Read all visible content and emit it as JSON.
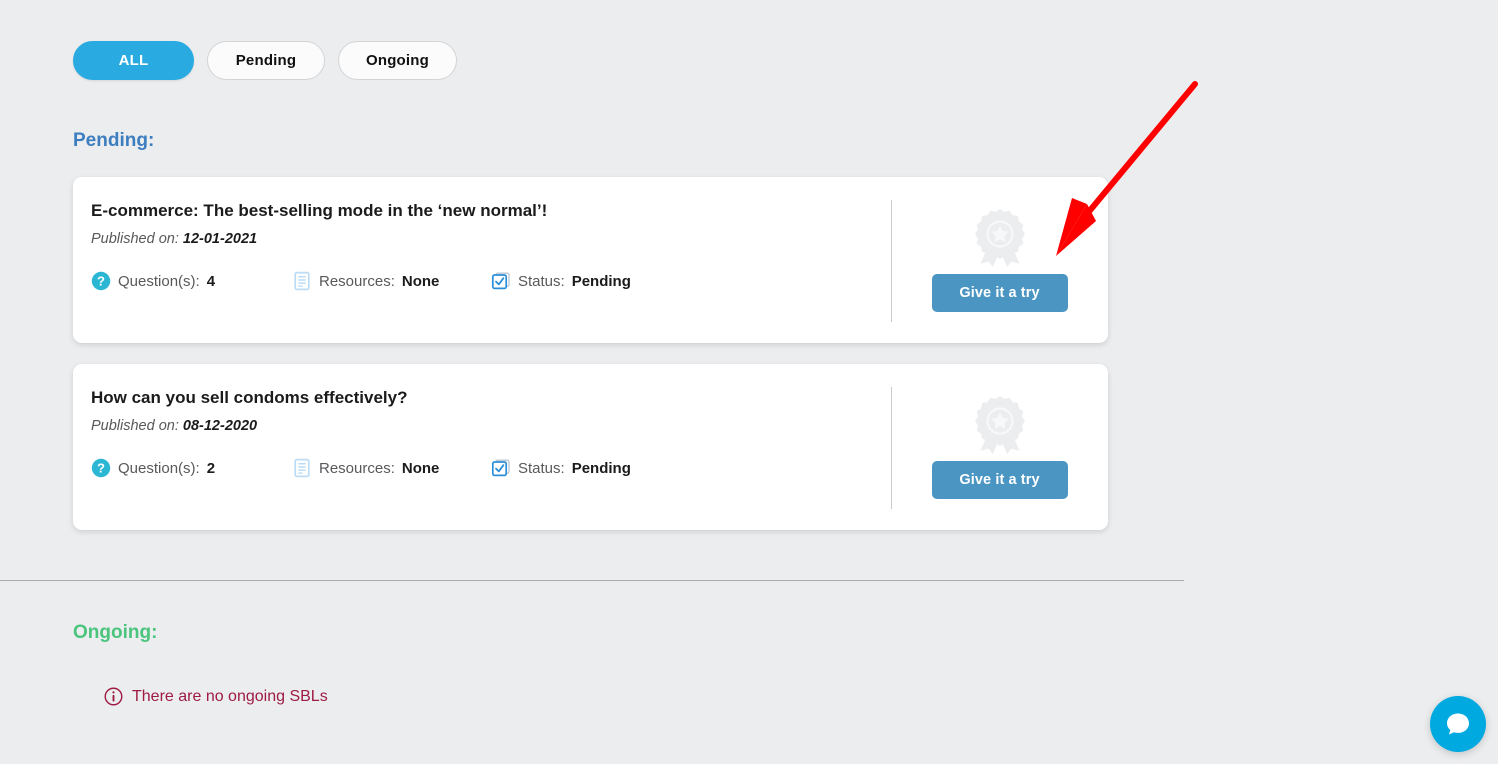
{
  "filters": {
    "tabs": [
      {
        "label": "ALL",
        "active": true,
        "name": "filter-tab-all"
      },
      {
        "label": "Pending",
        "active": false,
        "name": "filter-tab-pending"
      },
      {
        "label": "Ongoing",
        "active": false,
        "name": "filter-tab-ongoing"
      }
    ]
  },
  "sections": {
    "pending": {
      "heading": "Pending:",
      "heading_color": "#3d7ec0"
    },
    "ongoing": {
      "heading": "Ongoing:",
      "heading_color": "#4bc47d",
      "empty_message": "There are no ongoing SBLs",
      "empty_icon": "info-circle-icon",
      "empty_color": "#9e1b43"
    }
  },
  "cards": [
    {
      "title": "E-commerce: The best-selling mode in the ‘new normal’!",
      "published_label": "Published on:",
      "published_date": "12-01-2021",
      "meta": [
        {
          "icon": "question-circle-icon",
          "label": "Question(s):",
          "value": "4"
        },
        {
          "icon": "document-icon",
          "label": "Resources:",
          "value": "None"
        },
        {
          "icon": "checkbox-checked-icon",
          "label": "Status:",
          "value": "Pending"
        }
      ],
      "badge_icon": "award-ribbon-icon",
      "action_label": "Give it a try"
    },
    {
      "title": "How can you sell condoms effectively?",
      "published_label": "Published on:",
      "published_date": "08-12-2020",
      "meta": [
        {
          "icon": "question-circle-icon",
          "label": "Question(s):",
          "value": "2"
        },
        {
          "icon": "document-icon",
          "label": "Resources:",
          "value": "None"
        },
        {
          "icon": "checkbox-checked-icon",
          "label": "Status:",
          "value": "Pending"
        }
      ],
      "badge_icon": "award-ribbon-icon",
      "action_label": "Give it a try"
    }
  ],
  "chat": {
    "icon": "chat-bubble-icon",
    "color": "#00a9e0"
  },
  "annotation": {
    "type": "arrow",
    "color": "#ff0000",
    "points_to": "Give it a try"
  },
  "colors": {
    "background": "#ecedef",
    "card": "#ffffff",
    "accent_cyan": "#29abe2",
    "button_blue": "#4b95c3",
    "text_muted": "#58595b",
    "text_dark": "#1b1b1b"
  }
}
